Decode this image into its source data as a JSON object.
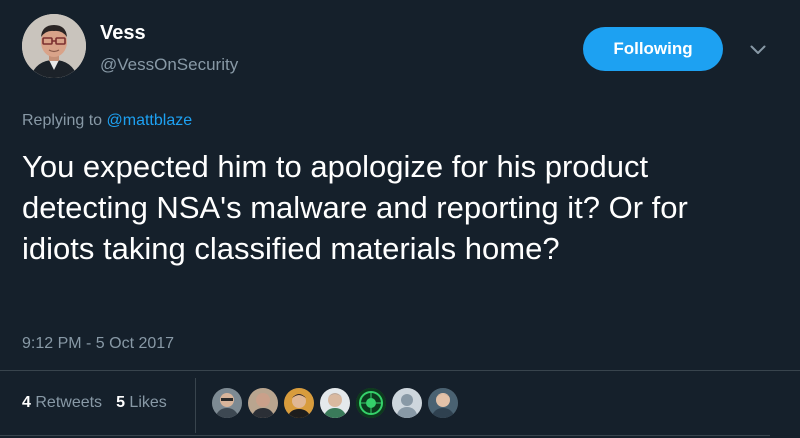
{
  "tweet": {
    "author_name": "Vess",
    "author_handle": "@VessOnSecurity",
    "follow_button_label": "Following",
    "replying_prefix": "Replying to",
    "replying_to": "@mattblaze",
    "text": "You expected him to apologize for his product detecting NSA's malware and reporting it? Or for idiots taking classified materials home?",
    "timestamp": "9:12 PM - 5 Oct 2017"
  },
  "stats": {
    "retweets_count": "4",
    "retweets_label": "Retweets",
    "likes_count": "5",
    "likes_label": "Likes"
  },
  "icons": {
    "menu": "chevron-down-icon"
  },
  "colors": {
    "background": "#15202b",
    "accent": "#1da1f2",
    "secondary_text": "#8899a6",
    "divider": "#38444d"
  }
}
